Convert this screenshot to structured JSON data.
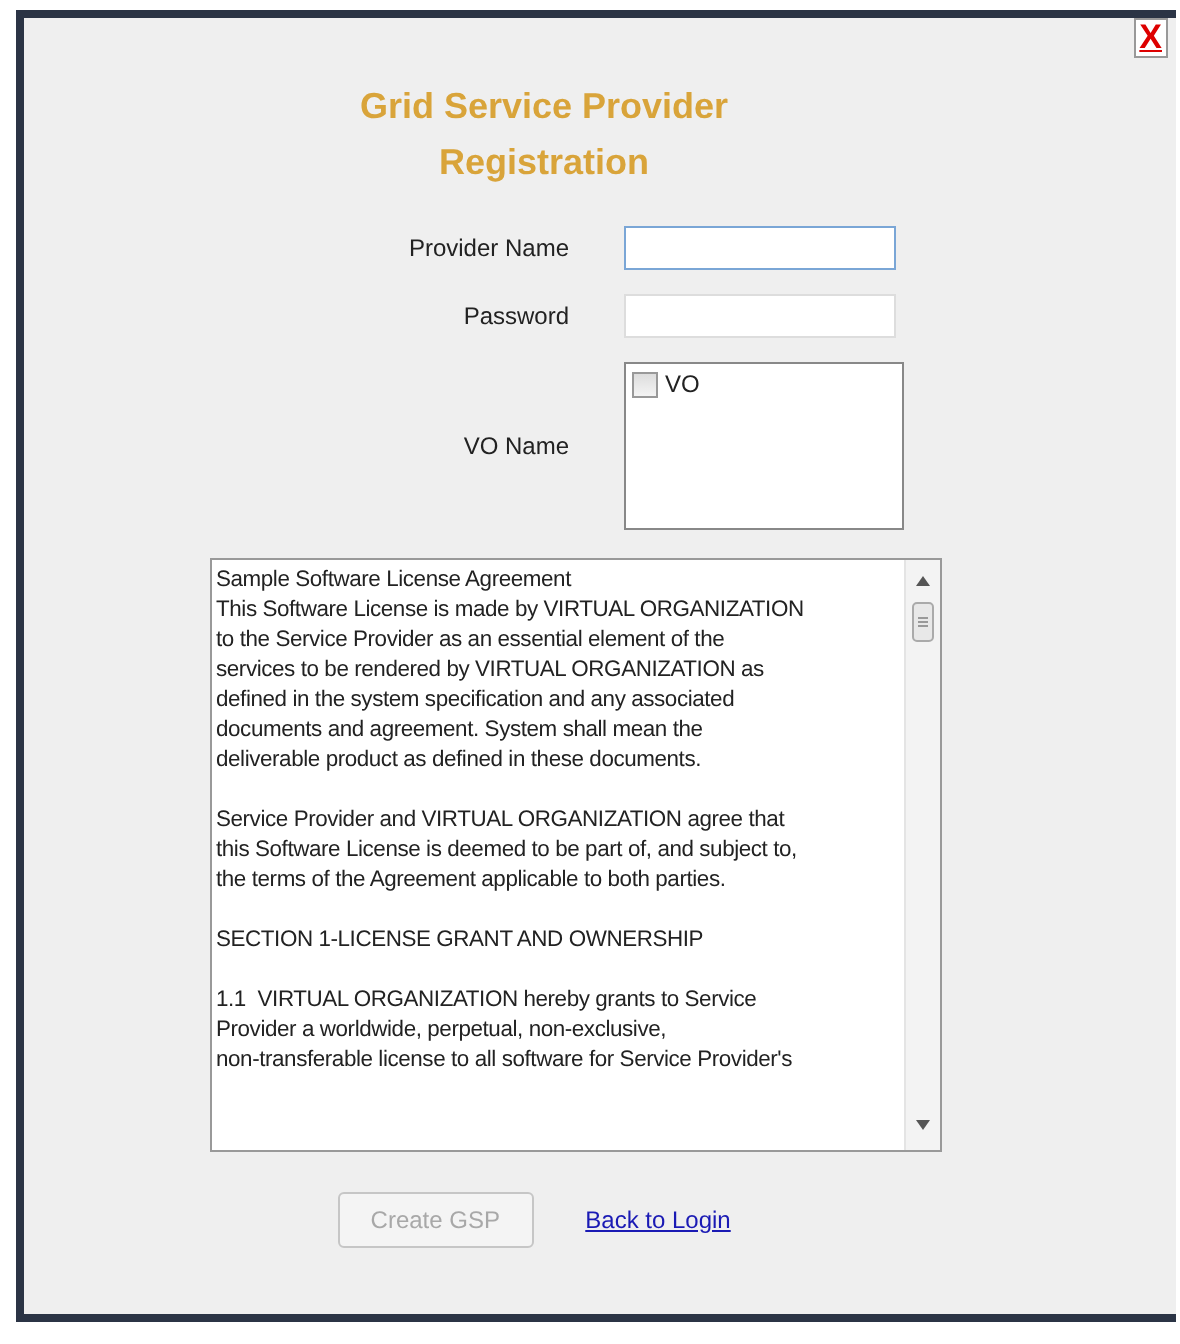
{
  "close_button": {
    "label": "X"
  },
  "title": "Grid Service Provider Registration",
  "fields": [
    {
      "label": "Provider Name",
      "focused": true
    },
    {
      "label": "Password",
      "focused": false
    }
  ],
  "vo_name": {
    "label": "VO Name",
    "options": [
      {
        "label": "VO",
        "checked": false
      }
    ]
  },
  "license": {
    "paragraphs": [
      "Sample Software License Agreement\nThis Software License is made by VIRTUAL ORGANIZATION\nto the Service Provider as an essential element of the\nservices to be rendered by VIRTUAL ORGANIZATION as\ndefined in the system specification and any associated\ndocuments and agreement. System shall mean the\ndeliverable product as defined in these documents.",
      "Service Provider and VIRTUAL ORGANIZATION agree that\nthis Software License is deemed to be part of, and subject to,\nthe terms of the Agreement applicable to both parties.",
      "SECTION 1-LICENSE GRANT AND OWNERSHIP",
      "1.1  VIRTUAL ORGANIZATION hereby grants to Service\nProvider a worldwide, perpetual, non-exclusive,\nnon-transferable license to all software for Service Provider's"
    ]
  },
  "buttons": [
    {
      "label": "Create GSP",
      "disabled": true
    }
  ],
  "link": "Back to Login"
}
